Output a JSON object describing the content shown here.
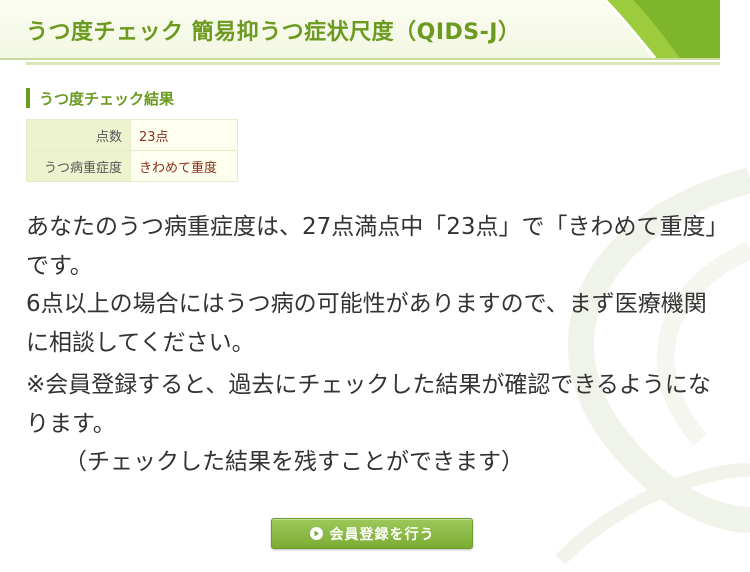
{
  "header": {
    "title": "うつ度チェック 簡易抑うつ症状尺度（QIDS-J）"
  },
  "section": {
    "heading": "うつ度チェック結果"
  },
  "result_table": [
    {
      "label": "点数",
      "value": "23点"
    },
    {
      "label": "うつ病重症度",
      "value": "きわめて重度"
    }
  ],
  "message": {
    "severity": "あなたのうつ病重症度は、27点満点中「23点」で「きわめて重度」です。",
    "advice": "6点以上の場合にはうつ病の可能性がありますので、まず医療機関に相談してください。",
    "member_note": "※会員登録すると、過去にチェックした結果が確認できるようになります。",
    "member_note_sub": "（チェックした結果を残すことができます）"
  },
  "register_button": {
    "label": "会員登録を行う",
    "icon": "play-circle-icon"
  },
  "colors": {
    "accent": "#6c9a20",
    "value_text": "#8b2e1c",
    "button": "#8cba47"
  }
}
